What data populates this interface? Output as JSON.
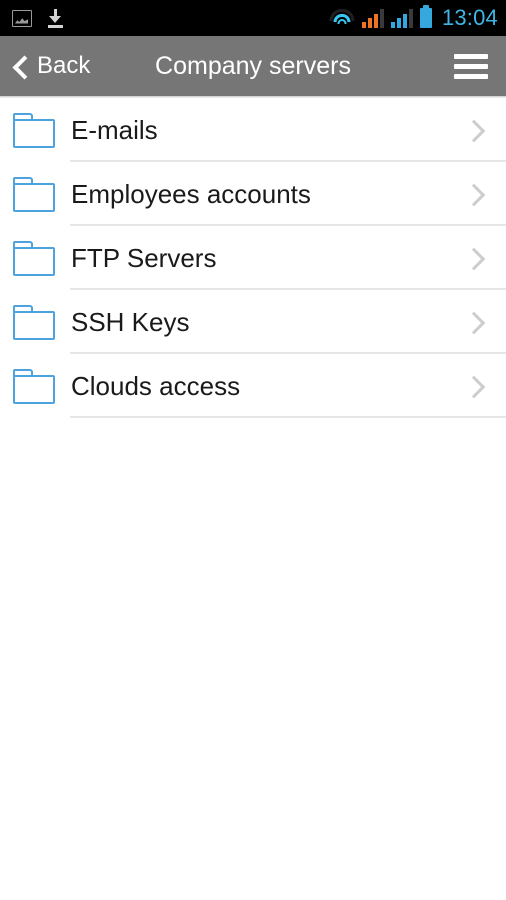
{
  "status_bar": {
    "left_icons": [
      {
        "name": "gallery-icon",
        "glyph": "image"
      },
      {
        "name": "download-icon",
        "glyph": "download-arrow"
      }
    ],
    "right_icons": [
      {
        "name": "wifi-icon",
        "glyph": "wifi",
        "color": "#37c6f0"
      },
      {
        "name": "signal-sim1-icon",
        "glyph": "signal-bars",
        "color": "#ef7422",
        "bars": 3
      },
      {
        "name": "signal-sim2-icon",
        "glyph": "signal-bars",
        "color": "#2fa9e0",
        "bars": 3
      },
      {
        "name": "battery-icon",
        "glyph": "battery-full",
        "color": "#35a8dd"
      }
    ],
    "clock": "13:04",
    "background": "#000000"
  },
  "header": {
    "back_label": "Back",
    "back_icon": "chevron-left-icon",
    "title": "Company servers",
    "menu_icon": "hamburger-menu-icon",
    "background": "#767676",
    "text_color": "#ffffff"
  },
  "list": {
    "folder_icon_color": "#4da3dd",
    "chevron_color": "#cdcdcd",
    "items": [
      {
        "label": "E-mails",
        "icon": "folder-icon",
        "accessory": "chevron-right-icon"
      },
      {
        "label": "Employees accounts",
        "icon": "folder-icon",
        "accessory": "chevron-right-icon"
      },
      {
        "label": "FTP Servers",
        "icon": "folder-icon",
        "accessory": "chevron-right-icon"
      },
      {
        "label": "SSH Keys",
        "icon": "folder-icon",
        "accessory": "chevron-right-icon"
      },
      {
        "label": "Clouds access",
        "icon": "folder-icon",
        "accessory": "chevron-right-icon"
      }
    ]
  }
}
